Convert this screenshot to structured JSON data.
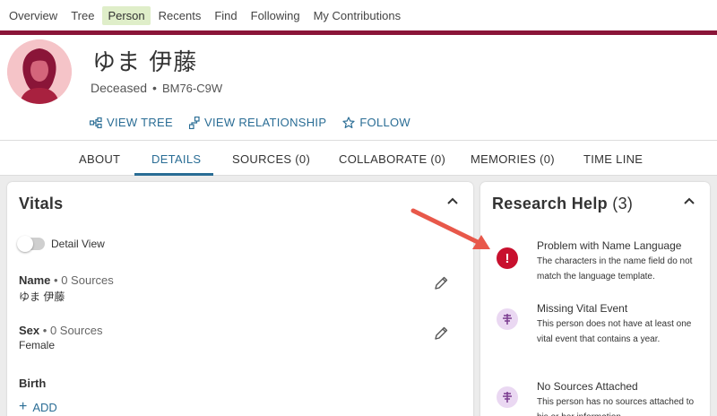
{
  "nav": {
    "items": [
      "Overview",
      "Tree",
      "Person",
      "Recents",
      "Find",
      "Following",
      "My Contributions"
    ],
    "active": "Person"
  },
  "person": {
    "name": "ゆま 伊藤",
    "status": "Deceased",
    "id": "BM76-C9W"
  },
  "actions": {
    "view_tree": "VIEW TREE",
    "view_relationship": "VIEW RELATIONSHIP",
    "follow": "FOLLOW"
  },
  "tabs": [
    "ABOUT",
    "DETAILS",
    "SOURCES (0)",
    "COLLABORATE (0)",
    "MEMORIES (0)",
    "TIME LINE"
  ],
  "active_tab": "DETAILS",
  "vitals": {
    "title": "Vitals",
    "detail_view": "Detail View",
    "name": {
      "label": "Name",
      "sources": "0 Sources",
      "value": "ゆま 伊藤"
    },
    "sex": {
      "label": "Sex",
      "sources": "0 Sources",
      "value": "Female"
    },
    "birth": {
      "label": "Birth"
    },
    "add": "ADD"
  },
  "research": {
    "title": "Research Help",
    "count": "(3)",
    "items": [
      {
        "title": "Problem with Name Language",
        "desc": "The characters in the name field do not match the language template.",
        "icon": "error-icon"
      },
      {
        "title": "Missing Vital Event",
        "desc": "This person does not have at least one vital event that contains a year.",
        "icon": "tree-hint-icon"
      },
      {
        "title": "No Sources Attached",
        "desc": "This person has no sources attached to his or her information.",
        "icon": "tree-hint-icon"
      }
    ]
  },
  "colors": {
    "accent": "#2a6d95",
    "maroon": "#8a1538",
    "error": "#c8102e",
    "hint_bg": "#ead8f2",
    "arrow": "#e8584a"
  }
}
